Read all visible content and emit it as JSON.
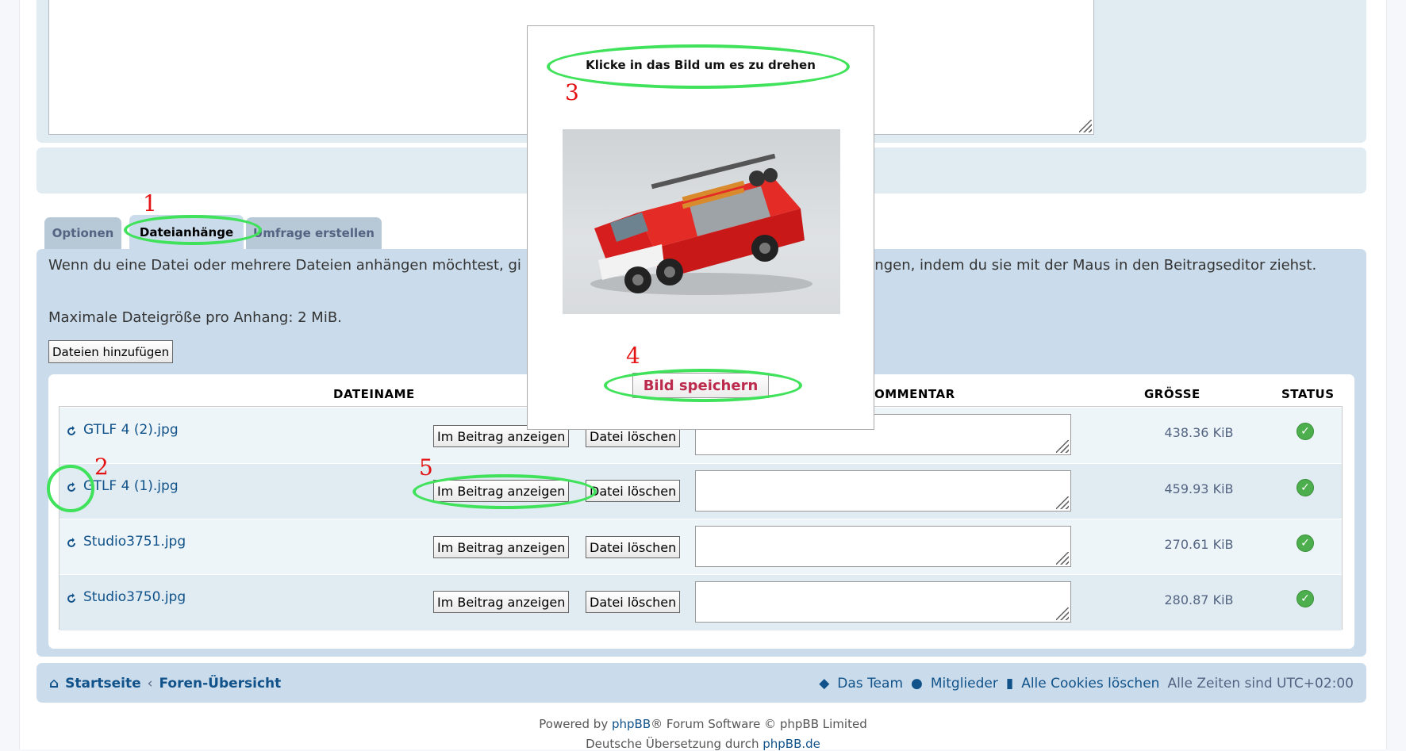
{
  "tabs": [
    {
      "label": "Optionen"
    },
    {
      "label": "Dateianhänge"
    },
    {
      "label": "Umfrage erstellen"
    }
  ],
  "attachments": {
    "intro": "Wenn du eine Datei oder mehrere Dateien anhängen möchtest, gi                                                                      anhängen, indem du sie mit der Maus in den Beitragseditor ziehst.",
    "max_size": "Maximale Dateigröße pro Anhang: 2 MiB.",
    "add_files_label": "Dateien hinzufügen",
    "columns": {
      "filename": "DATEINAME",
      "comment": "OMMENTAR",
      "size": "GRÖSSE",
      "status": "STATUS"
    },
    "show_in_post_label": "Im Beitrag anzeigen",
    "delete_label": "Datei löschen",
    "files": [
      {
        "name": "GTLF 4 (2).jpg",
        "size": "438.36 KiB"
      },
      {
        "name": "GTLF 4 (1).jpg",
        "size": "459.93 KiB"
      },
      {
        "name": "Studio3751.jpg",
        "size": "270.61 KiB"
      },
      {
        "name": "Studio3750.jpg",
        "size": "280.87 KiB"
      }
    ],
    "status_color": "#4cae4c"
  },
  "popup": {
    "title": "Klicke in das Bild um es zu drehen",
    "save_label": "Bild speichern"
  },
  "footer": {
    "home": "Startseite",
    "separator": "‹",
    "forum_index": "Foren-Übersicht",
    "team": "Das Team",
    "members": "Mitglieder",
    "cookies": "Alle Cookies löschen",
    "timezone": "Alle Zeiten sind UTC+02:00",
    "powered_prefix": "Powered by ",
    "powered_link": "phpBB",
    "powered_suffix": "® Forum Software © phpBB Limited",
    "translation_prefix": "Deutsche Übersetzung durch ",
    "translation_link": "phpBB.de"
  },
  "annotations": [
    "1",
    "2",
    "3",
    "4",
    "5"
  ],
  "colors": {
    "link": "#105289",
    "panel": "#cadceb",
    "highlight": "#3fe25a",
    "marker": "#e41212"
  }
}
